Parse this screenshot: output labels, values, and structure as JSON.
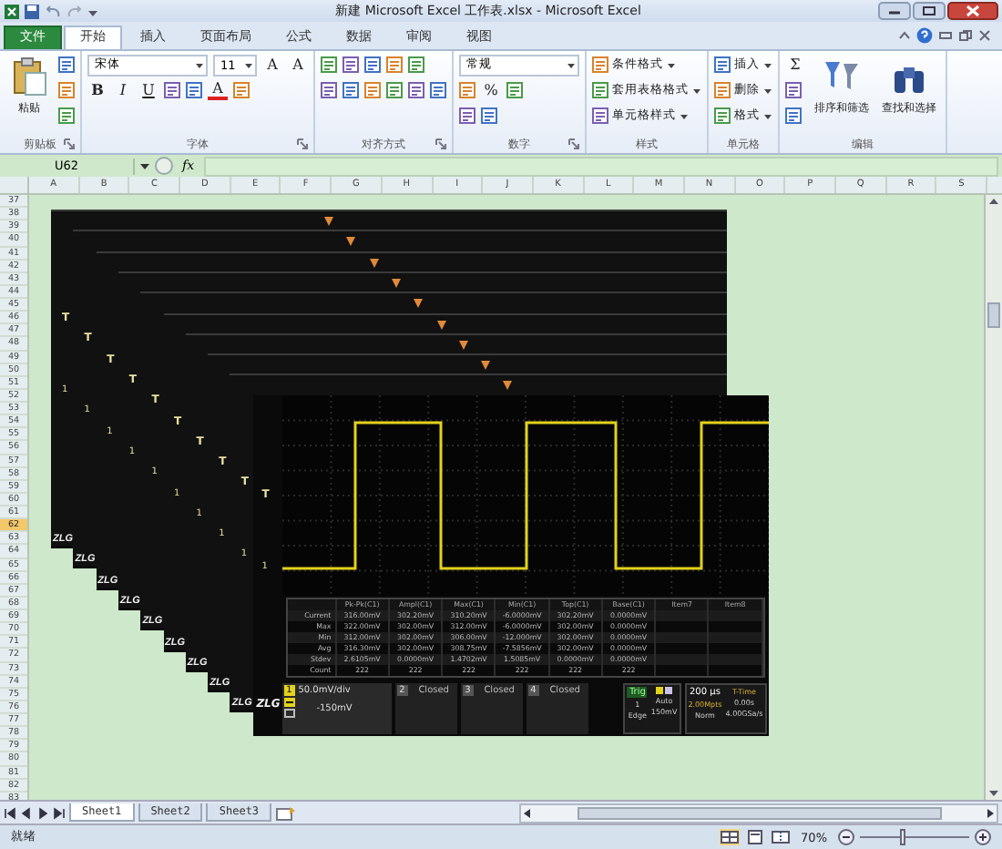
{
  "window": {
    "title": "新建 Microsoft Excel 工作表.xlsx - Microsoft Excel"
  },
  "tabs": [
    {
      "label": "文件",
      "kind": "file",
      "selected": false
    },
    {
      "label": "开始",
      "kind": "normal",
      "selected": true
    },
    {
      "label": "插入",
      "kind": "normal",
      "selected": false
    },
    {
      "label": "页面布局",
      "kind": "normal",
      "selected": false
    },
    {
      "label": "公式",
      "kind": "normal",
      "selected": false
    },
    {
      "label": "数据",
      "kind": "normal",
      "selected": false
    },
    {
      "label": "审阅",
      "kind": "normal",
      "selected": false
    },
    {
      "label": "视图",
      "kind": "normal",
      "selected": false
    }
  ],
  "ribbon_groups": [
    {
      "label": "剪贴板",
      "launcher": true,
      "blocks": [
        {
          "kind": "large",
          "label": "粘贴"
        },
        {
          "kind": "rows",
          "rows": [
            [
              {
                "kind": "icon"
              }
            ],
            [
              {
                "kind": "icon"
              }
            ],
            [
              {
                "kind": "icon"
              }
            ]
          ]
        }
      ]
    },
    {
      "label": "字体",
      "launcher": true,
      "blocks": [
        {
          "kind": "rows",
          "rows": [
            [
              {
                "kind": "combo",
                "value": "宋体",
                "wide": true
              },
              {
                "kind": "combo",
                "value": "11",
                "wide": false
              },
              {
                "kind": "glyph",
                "text": "A"
              },
              {
                "kind": "glyph",
                "text": "A"
              }
            ],
            [
              {
                "kind": "bold",
                "text": "B"
              },
              {
                "kind": "italic",
                "text": "I"
              },
              {
                "kind": "underline",
                "text": "U"
              },
              {
                "kind": "icon"
              },
              {
                "kind": "icon"
              },
              {
                "kind": "font_color",
                "text": "A"
              },
              {
                "kind": "icon"
              }
            ]
          ]
        }
      ]
    },
    {
      "label": "对齐方式",
      "launcher": true,
      "blocks": [
        {
          "kind": "rows",
          "rows": [
            [
              {
                "kind": "icon"
              },
              {
                "kind": "icon"
              },
              {
                "kind": "icon"
              },
              {
                "kind": "icon"
              },
              {
                "kind": "icon"
              }
            ],
            [
              {
                "kind": "icon"
              },
              {
                "kind": "icon"
              },
              {
                "kind": "icon"
              },
              {
                "kind": "icon"
              },
              {
                "kind": "icon"
              },
              {
                "kind": "icon"
              }
            ]
          ]
        }
      ]
    },
    {
      "label": "数字",
      "launcher": true,
      "blocks": [
        {
          "kind": "rows",
          "rows": [
            [
              {
                "kind": "combo",
                "value": "常规",
                "wide": true
              }
            ],
            [
              {
                "kind": "icon"
              },
              {
                "kind": "glyph",
                "text": "%"
              },
              {
                "kind": "icon"
              }
            ],
            [
              {
                "kind": "icon"
              },
              {
                "kind": "icon"
              }
            ]
          ]
        }
      ]
    },
    {
      "label": "样式",
      "launcher": false,
      "blocks": [
        {
          "kind": "rows",
          "rows": [
            [
              {
                "kind": "item",
                "label": "条件格式"
              }
            ],
            [
              {
                "kind": "item",
                "label": "套用表格格式"
              }
            ],
            [
              {
                "kind": "item",
                "label": "单元格样式"
              }
            ]
          ]
        }
      ]
    },
    {
      "label": "单元格",
      "launcher": false,
      "blocks": [
        {
          "kind": "rows",
          "rows": [
            [
              {
                "kind": "item",
                "label": "插入"
              }
            ],
            [
              {
                "kind": "item",
                "label": "删除"
              }
            ],
            [
              {
                "kind": "item",
                "label": "格式"
              }
            ]
          ]
        }
      ]
    },
    {
      "label": "编辑",
      "launcher": false,
      "blocks": [
        {
          "kind": "rows",
          "rows": [
            [
              {
                "kind": "glyph",
                "text": "Σ"
              }
            ],
            [
              {
                "kind": "icon"
              }
            ],
            [
              {
                "kind": "icon"
              }
            ]
          ]
        },
        {
          "kind": "large",
          "label": "排序和筛选"
        },
        {
          "kind": "large",
          "label": "查找和选择"
        }
      ]
    }
  ],
  "formula_bar": {
    "name_box": "U62",
    "function_label": "fx"
  },
  "columns": [
    {
      "label": "A",
      "selected": false
    },
    {
      "label": "B",
      "selected": false
    },
    {
      "label": "C",
      "selected": false
    },
    {
      "label": "D",
      "selected": false
    },
    {
      "label": "E",
      "selected": false
    },
    {
      "label": "F",
      "selected": false
    },
    {
      "label": "G",
      "selected": false
    },
    {
      "label": "H",
      "selected": false
    },
    {
      "label": "I",
      "selected": false
    },
    {
      "label": "J",
      "selected": false
    },
    {
      "label": "K",
      "selected": false
    },
    {
      "label": "L",
      "selected": false
    },
    {
      "label": "M",
      "selected": false
    },
    {
      "label": "N",
      "selected": false
    },
    {
      "label": "O",
      "selected": false
    },
    {
      "label": "P",
      "selected": false
    },
    {
      "label": "Q",
      "selected": false
    },
    {
      "label": "R",
      "selected": false
    },
    {
      "label": "S",
      "selected": false
    }
  ],
  "rows": [
    {
      "label": "37",
      "selected": false
    },
    {
      "label": "38",
      "selected": false
    },
    {
      "label": "39",
      "selected": false
    },
    {
      "label": "40",
      "selected": false
    },
    {
      "label": "41",
      "selected": false
    },
    {
      "label": "42",
      "selected": false
    },
    {
      "label": "43",
      "selected": false
    },
    {
      "label": "44",
      "selected": false
    },
    {
      "label": "45",
      "selected": false
    },
    {
      "label": "46",
      "selected": false
    },
    {
      "label": "47",
      "selected": false
    },
    {
      "label": "48",
      "selected": false
    },
    {
      "label": "49",
      "selected": false
    },
    {
      "label": "50",
      "selected": false
    },
    {
      "label": "51",
      "selected": false
    },
    {
      "label": "52",
      "selected": false
    },
    {
      "label": "53",
      "selected": false
    },
    {
      "label": "54",
      "selected": false
    },
    {
      "label": "55",
      "selected": false
    },
    {
      "label": "56",
      "selected": false
    },
    {
      "label": "57",
      "selected": false
    },
    {
      "label": "58",
      "selected": false
    },
    {
      "label": "59",
      "selected": false
    },
    {
      "label": "60",
      "selected": false
    },
    {
      "label": "61",
      "selected": false
    },
    {
      "label": "62",
      "selected": true
    },
    {
      "label": "63",
      "selected": false
    },
    {
      "label": "64",
      "selected": false
    },
    {
      "label": "65",
      "selected": false
    },
    {
      "label": "66",
      "selected": false
    },
    {
      "label": "67",
      "selected": false
    },
    {
      "label": "68",
      "selected": false
    },
    {
      "label": "69",
      "selected": false
    },
    {
      "label": "70",
      "selected": false
    },
    {
      "label": "71",
      "selected": false
    },
    {
      "label": "72",
      "selected": false
    },
    {
      "label": "73",
      "selected": false
    },
    {
      "label": "74",
      "selected": false
    },
    {
      "label": "75",
      "selected": false
    },
    {
      "label": "76",
      "selected": false
    },
    {
      "label": "77",
      "selected": false
    },
    {
      "label": "78",
      "selected": false
    },
    {
      "label": "79",
      "selected": false
    },
    {
      "label": "80",
      "selected": false
    },
    {
      "label": "81",
      "selected": false
    },
    {
      "label": "82",
      "selected": false
    },
    {
      "label": "83",
      "selected": false
    }
  ],
  "scope_layers": [
    {
      "logo": "ZLG",
      "trigger_label": "T",
      "channel_label": "1"
    },
    {
      "logo": "ZLG",
      "trigger_label": "T",
      "channel_label": "1"
    },
    {
      "logo": "ZLG",
      "trigger_label": "T",
      "channel_label": "1"
    },
    {
      "logo": "ZLG",
      "trigger_label": "T",
      "channel_label": "1"
    },
    {
      "logo": "ZLG",
      "trigger_label": "T",
      "channel_label": "1"
    },
    {
      "logo": "ZLG",
      "trigger_label": "T",
      "channel_label": "1"
    },
    {
      "logo": "ZLG",
      "trigger_label": "T",
      "channel_label": "1"
    },
    {
      "logo": "ZLG",
      "trigger_label": "T",
      "channel_label": "1"
    },
    {
      "logo": "ZLG",
      "trigger_label": "T",
      "channel_label": "1"
    }
  ],
  "scope_main": {
    "logo": "ZLG",
    "trigger_label": "T",
    "channel_label": "1",
    "measurement_columns": [
      "Pk-Pk(C1)",
      "Ampl(C1)",
      "Max(C1)",
      "Min(C1)",
      "Top(C1)",
      "Base(C1)",
      "Item7",
      "Item8"
    ],
    "measurement_rows": [
      {
        "label": "Current",
        "values": [
          "316.00mV",
          "302.20mV",
          "310.20mV",
          "-6.0000mV",
          "302.20mV",
          "0.0000mV"
        ]
      },
      {
        "label": "Max",
        "values": [
          "322.00mV",
          "302.00mV",
          "312.00mV",
          "-6.0000mV",
          "302.00mV",
          "0.0000mV"
        ]
      },
      {
        "label": "Min",
        "values": [
          "312.00mV",
          "302.00mV",
          "306.00mV",
          "-12.000mV",
          "302.00mV",
          "0.0000mV"
        ]
      },
      {
        "label": "Avg",
        "values": [
          "316.30mV",
          "302.00mV",
          "308.75mV",
          "-7.5856mV",
          "302.00mV",
          "0.0000mV"
        ]
      },
      {
        "label": "Stdev",
        "values": [
          "2.6105mV",
          "0.0000mV",
          "1.4702mV",
          "1.5085mV",
          "0.0000mV",
          "0.0000mV"
        ]
      },
      {
        "label": "Count",
        "values": [
          "222",
          "222",
          "222",
          "222",
          "222",
          "222"
        ]
      }
    ],
    "channels": [
      {
        "number": "1",
        "kind": "active",
        "scale": "50.0mV/div",
        "offset": "-150mV"
      },
      {
        "number": "2",
        "kind": "closed",
        "status": "Closed"
      },
      {
        "number": "3",
        "kind": "closed",
        "status": "Closed"
      },
      {
        "number": "4",
        "kind": "closed",
        "status": "Closed"
      }
    ],
    "trigger": {
      "title": "Trig",
      "source": "1",
      "type": "Edge",
      "mode": "Auto",
      "voltage": "150mV"
    },
    "timebase": {
      "scale": "200 μs",
      "t_time_label": "T-Time",
      "t_time": "0.00s",
      "memory": "2.00Mpts",
      "acq_mode": "Norm",
      "sample_rate": "4.00GSa/s"
    }
  },
  "sheet_tabs": [
    {
      "label": "Sheet1",
      "selected": true
    },
    {
      "label": "Sheet2",
      "selected": false
    },
    {
      "label": "Sheet3",
      "selected": false
    }
  ],
  "status_bar": {
    "text": "就绪",
    "zoom": "70%",
    "zoom_slider": {
      "level": 0.4
    },
    "views": [
      {
        "kind": "normal",
        "selected": true
      },
      {
        "kind": "layout",
        "selected": false
      },
      {
        "kind": "break",
        "selected": false
      }
    ]
  }
}
